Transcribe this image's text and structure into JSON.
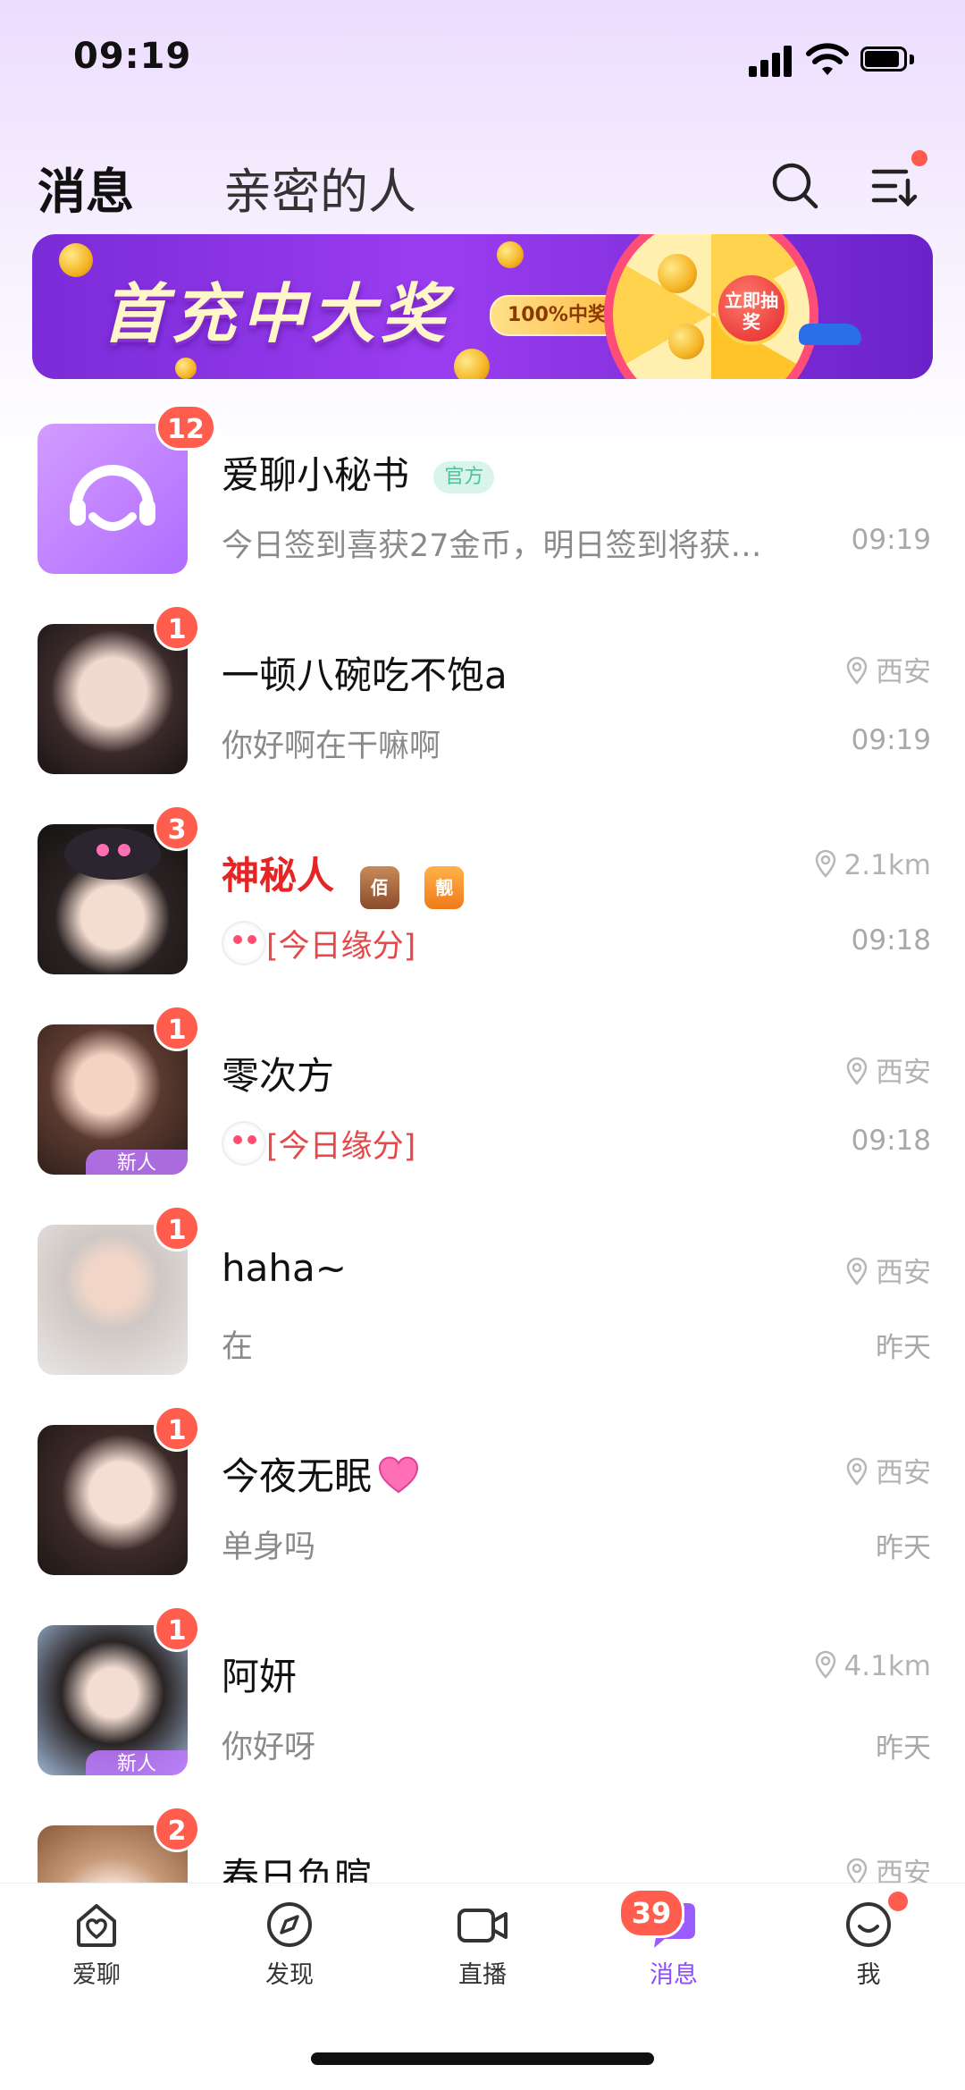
{
  "status_bar": {
    "time": "09:19"
  },
  "header": {
    "tab_messages": "消息",
    "tab_intimate": "亲密的人"
  },
  "banner": {
    "title": "首充中大奖",
    "tag": "100%中奖",
    "wheel_button": "立即抽奖"
  },
  "conversations": [
    {
      "name": "爱聊小秘书",
      "official_label": "官方",
      "preview": "今日签到喜获27金币，明日签到将获…",
      "time": "09:19",
      "badge": "12"
    },
    {
      "name": "一顿八碗吃不饱a",
      "preview": "你好啊在干嘛啊",
      "time": "09:19",
      "location": "西安",
      "badge": "1"
    },
    {
      "name": "神秘人",
      "preview": "[今日缘分]",
      "time": "09:18",
      "location": "2.1km",
      "badge": "3",
      "medals": [
        "佰",
        "靓"
      ]
    },
    {
      "name": "零次方",
      "preview": "[今日缘分]",
      "time": "09:18",
      "location": "西安",
      "badge": "1",
      "new_tag": "新人"
    },
    {
      "name": "haha~",
      "preview": "在",
      "time": "昨天",
      "location": "西安",
      "badge": "1"
    },
    {
      "name": "今夜无眠",
      "preview": "单身吗",
      "time": "昨天",
      "location": "西安",
      "badge": "1"
    },
    {
      "name": "阿妍",
      "preview": "你好呀",
      "time": "昨天",
      "location": "4.1km",
      "badge": "1",
      "new_tag": "新人"
    },
    {
      "name": "春日负暄",
      "location": "西安",
      "badge": "2"
    }
  ],
  "bottom_nav": {
    "items": [
      {
        "label": "爱聊",
        "icon": "home-heart-icon"
      },
      {
        "label": "发现",
        "icon": "compass-icon"
      },
      {
        "label": "直播",
        "icon": "video-camera-icon"
      },
      {
        "label": "消息",
        "icon": "chat-bubble-icon"
      },
      {
        "label": "我",
        "icon": "smile-face-icon"
      }
    ],
    "messages_badge": "39"
  },
  "colors": {
    "accent": "#8a4dff",
    "badge": "#ff5d4d",
    "official_bg": "#d9f5ea",
    "highlight_red": "#e52424"
  }
}
